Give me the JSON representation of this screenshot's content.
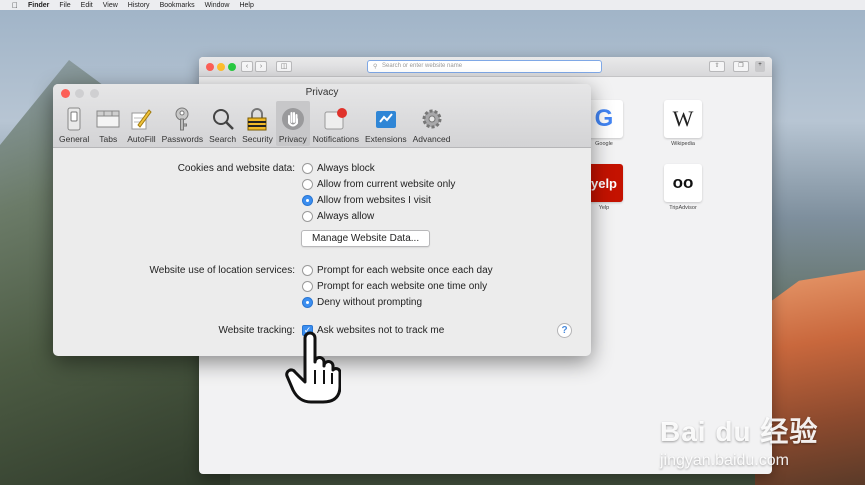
{
  "menubar": {
    "items": [
      "Finder",
      "File",
      "Edit",
      "View",
      "History",
      "Bookmarks",
      "Window",
      "Help"
    ]
  },
  "safari": {
    "address_placeholder": "Search or enter website name",
    "favorites": [
      {
        "label": "Google",
        "glyph": "G"
      },
      {
        "label": "Wikipedia",
        "glyph": "W"
      },
      {
        "label": "Yelp",
        "glyph": "yelp"
      },
      {
        "label": "TripAdvisor",
        "glyph": "oo"
      }
    ]
  },
  "prefs": {
    "title": "Privacy",
    "tabs": [
      {
        "label": "General",
        "icon": "switch-icon"
      },
      {
        "label": "Tabs",
        "icon": "tabs-icon"
      },
      {
        "label": "AutoFill",
        "icon": "pencil-icon"
      },
      {
        "label": "Passwords",
        "icon": "key-icon"
      },
      {
        "label": "Search",
        "icon": "magnifier-icon"
      },
      {
        "label": "Security",
        "icon": "padlock-icon"
      },
      {
        "label": "Privacy",
        "icon": "hand-icon"
      },
      {
        "label": "Notifications",
        "icon": "notification-icon"
      },
      {
        "label": "Extensions",
        "icon": "puzzle-icon"
      },
      {
        "label": "Advanced",
        "icon": "gear-icon"
      }
    ],
    "active_tab": "Privacy",
    "cookies": {
      "label": "Cookies and website data:",
      "options": [
        "Always block",
        "Allow from current website only",
        "Allow from websites I visit",
        "Always allow"
      ],
      "selected": "Allow from websites I visit",
      "manage_button": "Manage Website Data..."
    },
    "location": {
      "label": "Website use of location services:",
      "options": [
        "Prompt for each website once each day",
        "Prompt for each website one time only",
        "Deny without prompting"
      ],
      "selected": "Deny without prompting"
    },
    "tracking": {
      "label": "Website tracking:",
      "checkbox_label": "Ask websites not to track me",
      "checked": true
    },
    "help_glyph": "?"
  },
  "watermark": {
    "logo": "Bai du 经验",
    "url": "jingyan.baidu.com"
  }
}
